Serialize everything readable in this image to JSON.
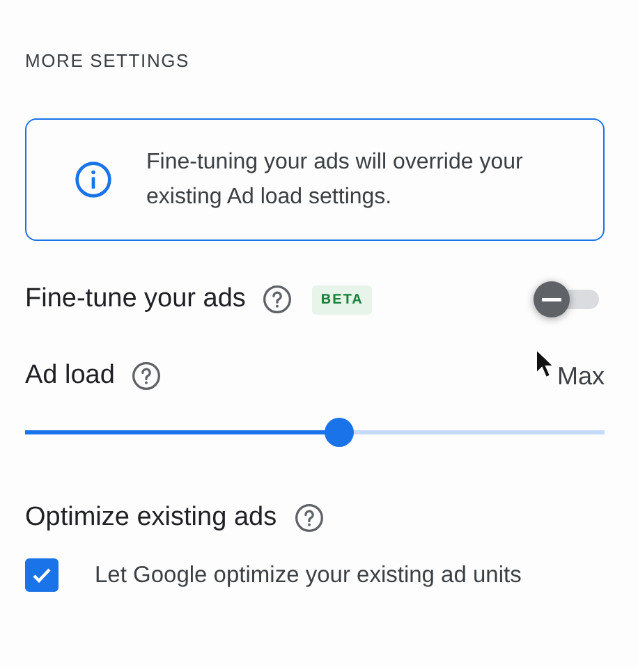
{
  "section_title": "MORE SETTINGS",
  "info_banner": {
    "text": "Fine-tuning your ads will override your existing Ad load settings."
  },
  "fine_tune": {
    "label": "Fine-tune your ads",
    "badge": "BETA",
    "on": false
  },
  "ad_load": {
    "label": "Ad load",
    "max_label": "Max",
    "level": 0.54
  },
  "optimize": {
    "heading": "Optimize existing ads",
    "option": {
      "label": "Let Google optimize your existing ad units",
      "checked": true
    }
  }
}
